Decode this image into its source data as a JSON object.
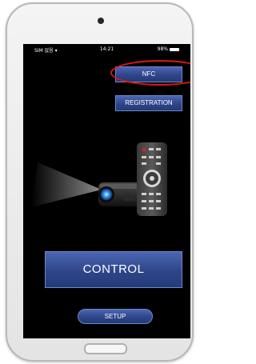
{
  "status": {
    "carrier": "SIM 없음",
    "time": "14:21",
    "battery": "98%"
  },
  "buttons": {
    "nfc": "NFC",
    "registration": "REGISTRATION",
    "control": "CONTROL",
    "setup": "SETUP"
  },
  "colors": {
    "button_top": "#4b66b3",
    "button_bottom": "#243a78",
    "highlight": "#e01515",
    "screen_bg": "#000000"
  }
}
